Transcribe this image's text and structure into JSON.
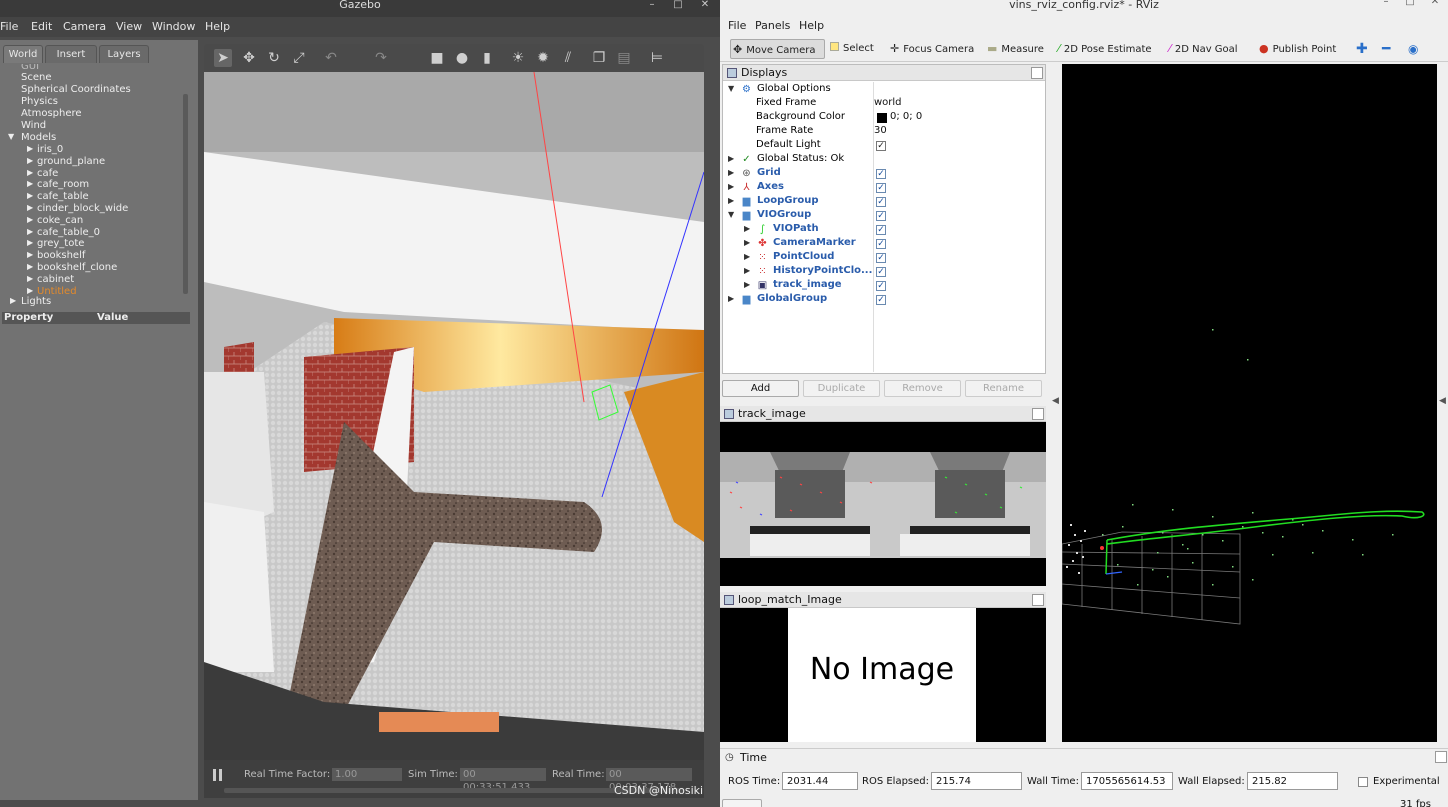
{
  "gazebo": {
    "title": "Gazebo",
    "menu": [
      "File",
      "Edit",
      "Camera",
      "View",
      "Window",
      "Help"
    ],
    "tabs": [
      "World",
      "Insert",
      "Layers"
    ],
    "tree": {
      "partial_top": "GUI",
      "items": [
        "Scene",
        "Spherical Coordinates",
        "Physics",
        "Atmosphere",
        "Wind"
      ],
      "models_label": "Models",
      "models": [
        "iris_0",
        "ground_plane",
        "cafe",
        "cafe_room",
        "cafe_table",
        "cinder_block_wide",
        "coke_can",
        "cafe_table_0",
        "grey_tote",
        "bookshelf",
        "bookshelf_clone",
        "cabinet"
      ],
      "highlighted_model": "Untitled",
      "lights_label": "Lights"
    },
    "property_header": {
      "property": "Property",
      "value": "Value"
    },
    "status": {
      "rtf_label": "Real Time Factor:",
      "rtf_value": "1.00",
      "sim_label": "Sim Time:",
      "sim_value": "00 00:33:51.433",
      "real_label": "Real Time:",
      "real_value": "00 00:03:37.178"
    }
  },
  "rviz": {
    "title": "vins_rviz_config.rviz* - RViz",
    "menu": [
      "File",
      "Panels",
      "Help"
    ],
    "toolbar": [
      "Move Camera",
      "Select",
      "Focus Camera",
      "Measure",
      "2D Pose Estimate",
      "2D Nav Goal",
      "Publish Point"
    ],
    "displays_title": "Displays",
    "displays": {
      "global_options": "Global Options",
      "fixed_frame_label": "Fixed Frame",
      "fixed_frame_value": "world",
      "bg_color_label": "Background Color",
      "bg_color_value": "0; 0; 0",
      "frame_rate_label": "Frame Rate",
      "frame_rate_value": "30",
      "default_light_label": "Default Light",
      "global_status": "Global Status: Ok",
      "grid": "Grid",
      "axes": "Axes",
      "loop_group": "LoopGroup",
      "vio_group": "VIOGroup",
      "vio_path": "VIOPath",
      "camera_marker": "CameraMarker",
      "point_cloud": "PointCloud",
      "history_point_cloud": "HistoryPointClo...",
      "track_image": "track_image",
      "global_group": "GlobalGroup"
    },
    "buttons": {
      "add": "Add",
      "duplicate": "Duplicate",
      "remove": "Remove",
      "rename": "Rename"
    },
    "track_image_title": "track_image",
    "loop_image_title": "loop_match_Image",
    "no_image": "No Image",
    "time_panel_title": "Time",
    "time": {
      "ros_time_label": "ROS Time:",
      "ros_time": "2031.44",
      "ros_elapsed_label": "ROS Elapsed:",
      "ros_elapsed": "215.74",
      "wall_time_label": "Wall Time:",
      "wall_time": "1705565614.53",
      "wall_elapsed_label": "Wall Elapsed:",
      "wall_elapsed": "215.82",
      "experimental": "Experimental",
      "fps": "31 fps"
    },
    "colors": {
      "path": "#22dd22",
      "points": "#7fd97f",
      "link": "#2a5cab"
    }
  },
  "watermark": "CSDN @Ninosiki"
}
